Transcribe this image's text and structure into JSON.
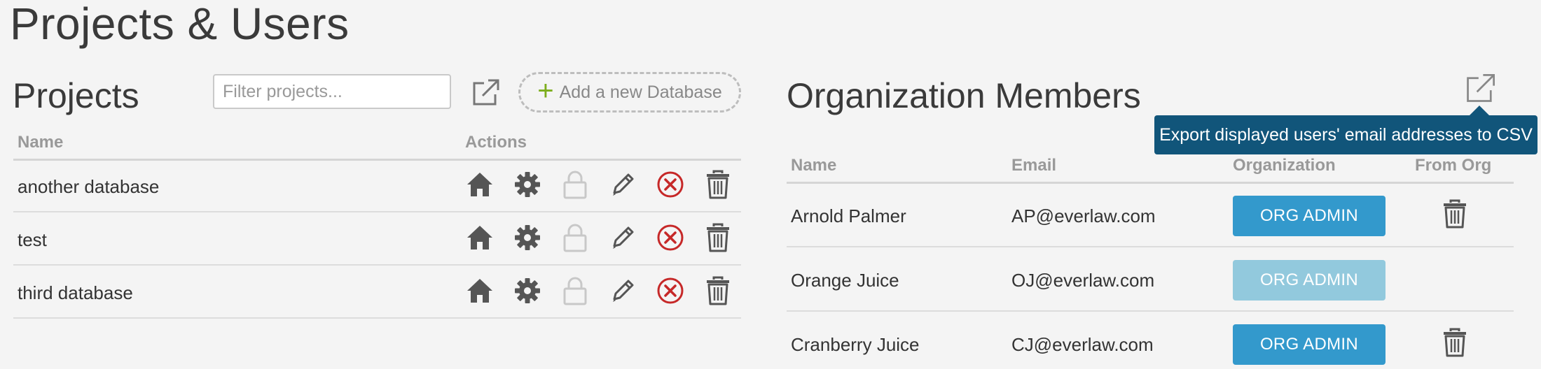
{
  "page_title": "Projects & Users",
  "projects": {
    "heading": "Projects",
    "filter_placeholder": "Filter projects...",
    "add_button_label": "Add a new Database",
    "columns": {
      "name": "Name",
      "actions": "Actions"
    },
    "rows": [
      {
        "name": "another database"
      },
      {
        "name": "test"
      },
      {
        "name": "third database"
      }
    ],
    "action_icons": [
      "home-icon",
      "gear-icon",
      "lock-icon",
      "pencil-icon",
      "close-circle-icon",
      "trash-icon"
    ]
  },
  "members": {
    "heading": "Organization Members",
    "export_tooltip": "Export displayed users' email addresses to CSV",
    "columns": {
      "name": "Name",
      "email": "Email",
      "organization": "Organization",
      "from_org": "From Org"
    },
    "rows": [
      {
        "name": "Arnold Palmer",
        "email": "AP@everlaw.com",
        "org_label": "ORG ADMIN",
        "org_enabled": true,
        "removable": true
      },
      {
        "name": "Orange Juice",
        "email": "OJ@everlaw.com",
        "org_label": "ORG ADMIN",
        "org_enabled": false,
        "removable": false
      },
      {
        "name": "Cranberry Juice",
        "email": "CJ@everlaw.com",
        "org_label": "ORG ADMIN",
        "org_enabled": true,
        "removable": true
      }
    ]
  },
  "colors": {
    "org_button_active": "#3399cc",
    "org_button_disabled": "#92c9dd",
    "tooltip_bg": "#11557a",
    "delete_red": "#c62828",
    "add_plus_green": "#7cad1c"
  }
}
